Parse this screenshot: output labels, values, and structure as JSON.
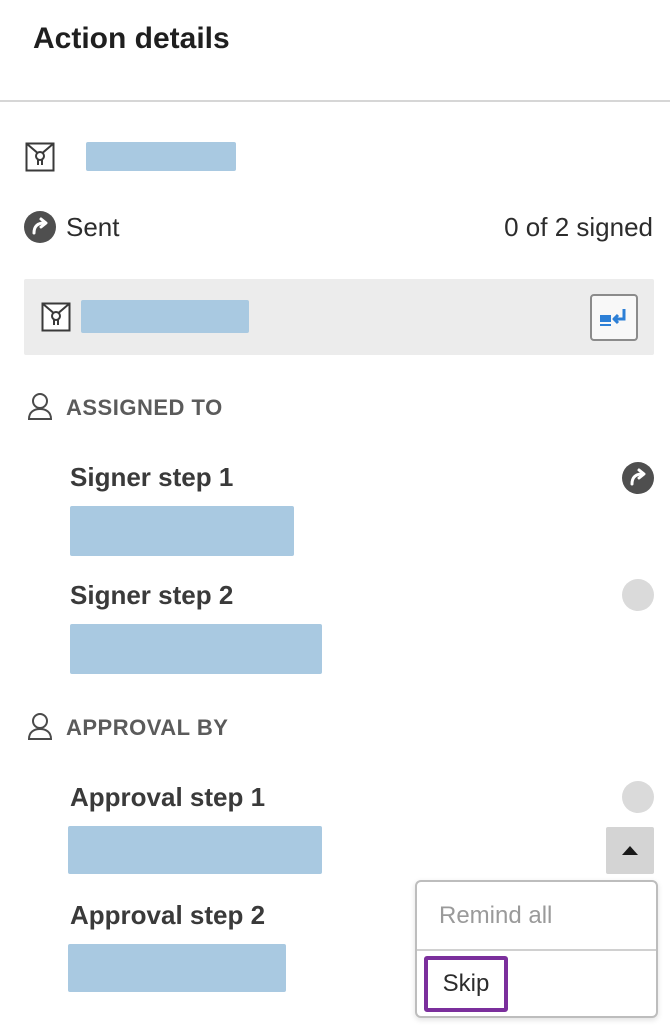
{
  "header": {
    "title": "Action details"
  },
  "agreement": {
    "status": "Sent",
    "signed_count": "0 of 2 signed"
  },
  "assigned_to": {
    "section_label": "ASSIGNED TO",
    "steps": [
      {
        "label": "Signer step 1",
        "status_icon": "sent-icon"
      },
      {
        "label": "Signer step 2",
        "status_icon": "pending-icon"
      }
    ]
  },
  "approval_by": {
    "section_label": "APPROVAL BY",
    "steps": [
      {
        "label": "Approval step 1",
        "status_icon": "pending-icon"
      },
      {
        "label": "Approval step 2",
        "status_icon": "none"
      }
    ]
  },
  "dropdown": {
    "items": [
      {
        "label": "Remind all",
        "enabled": false
      },
      {
        "label": "Skip",
        "enabled": true,
        "focused": true
      }
    ]
  },
  "colors": {
    "redacted": "#a9c9e1",
    "accent_blue": "#2c7fd6",
    "focus_outline": "#7b2f9c",
    "status_dark": "#4f4f4f",
    "status_pending": "#dadada"
  },
  "icons": {
    "document": "certificate-envelope-icon",
    "status": "forward-arrow-icon",
    "replace": "replace-document-icon",
    "person": "person-icon",
    "menu_toggle": "caret-up-icon"
  }
}
